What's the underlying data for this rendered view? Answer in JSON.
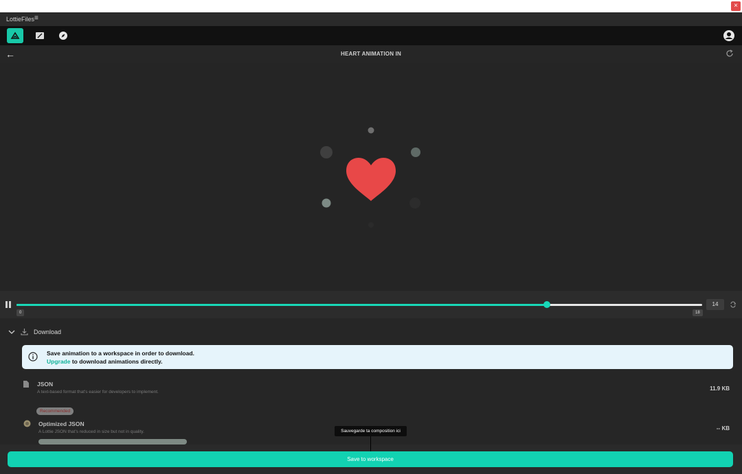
{
  "panel": {
    "title": "LottieFiles",
    "menu_glyph": "≡"
  },
  "window": {
    "close_glyph": "×"
  },
  "nav": {
    "tabs": [
      {
        "icon": "lottie-upload-icon",
        "active": true
      },
      {
        "icon": "edit-icon",
        "active": false
      },
      {
        "icon": "compass-icon",
        "active": false
      }
    ],
    "account_icon": "user-account-icon"
  },
  "header": {
    "back_glyph": "←",
    "title": "HEART ANIMATION IN",
    "refresh_icon": "refresh-icon"
  },
  "colors": {
    "accent": "#18d8b8",
    "heart": "#e84848",
    "background": "#242424"
  },
  "player": {
    "frame_start": "0",
    "frame_end": "18",
    "current_frame": "14",
    "progress_fraction": 0.774
  },
  "download": {
    "section_label": "Download",
    "info_line1": "Save animation to a workspace in order to download.",
    "upgrade_link": "Upgrade",
    "info_line2_rest": " to download animations directly.",
    "formats": [
      {
        "name": "JSON",
        "desc": "A text-based format that's easier for developers to implement.",
        "size": "11.9 KB"
      },
      {
        "name": "Optimized JSON",
        "desc": "A Lottie JSON that's reduced in size but not in quality.",
        "size": "-- KB"
      }
    ],
    "recommended_badge": "Recommended"
  },
  "tooltip": "Sauvegarde ta composition ici",
  "save_button": "Save to workspace"
}
